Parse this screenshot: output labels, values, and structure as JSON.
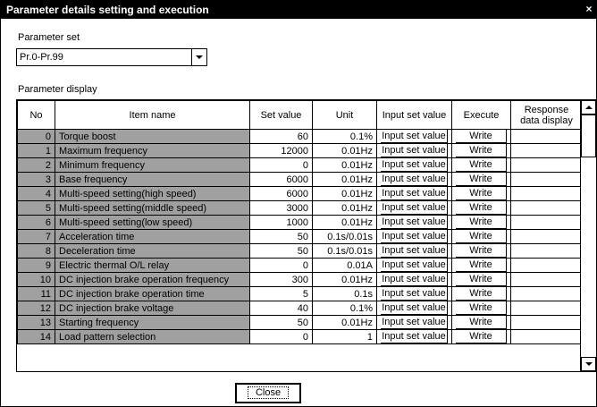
{
  "window": {
    "title": "Parameter details setting and execution",
    "close_glyph": "×"
  },
  "parameter_set": {
    "label": "Parameter set",
    "selected": "Pr.0-Pr.99"
  },
  "parameter_display": {
    "label": "Parameter display"
  },
  "table": {
    "headers": {
      "no": "No",
      "item_name": "Item name",
      "set_value": "Set value",
      "unit": "Unit",
      "input_set_value": "Input set value",
      "execute": "Execute",
      "response": "Response data display"
    },
    "rows": [
      {
        "no": "0",
        "name": "Torque boost",
        "value": "60",
        "unit": "0.1%",
        "input": "Input set value",
        "execute": "Write",
        "response": ""
      },
      {
        "no": "1",
        "name": "Maximum frequency",
        "value": "12000",
        "unit": "0.01Hz",
        "input": "Input set value",
        "execute": "Write",
        "response": ""
      },
      {
        "no": "2",
        "name": "Minimum frequency",
        "value": "0",
        "unit": "0.01Hz",
        "input": "Input set value",
        "execute": "Write",
        "response": ""
      },
      {
        "no": "3",
        "name": "Base frequency",
        "value": "6000",
        "unit": "0.01Hz",
        "input": "Input set value",
        "execute": "Write",
        "response": ""
      },
      {
        "no": "4",
        "name": "Multi-speed setting(high speed)",
        "value": "6000",
        "unit": "0.01Hz",
        "input": "Input set value",
        "execute": "Write",
        "response": ""
      },
      {
        "no": "5",
        "name": "Multi-speed setting(middle speed)",
        "value": "3000",
        "unit": "0.01Hz",
        "input": "Input set value",
        "execute": "Write",
        "response": ""
      },
      {
        "no": "6",
        "name": "Multi-speed setting(low speed)",
        "value": "1000",
        "unit": "0.01Hz",
        "input": "Input set value",
        "execute": "Write",
        "response": ""
      },
      {
        "no": "7",
        "name": "Acceleration time",
        "value": "50",
        "unit": "0.1s/0.01s",
        "input": "Input set value",
        "execute": "Write",
        "response": ""
      },
      {
        "no": "8",
        "name": "Deceleration time",
        "value": "50",
        "unit": "0.1s/0.01s",
        "input": "Input set value",
        "execute": "Write",
        "response": ""
      },
      {
        "no": "9",
        "name": "Electric thermal O/L relay",
        "value": "0",
        "unit": "0.01A",
        "input": "Input set value",
        "execute": "Write",
        "response": ""
      },
      {
        "no": "10",
        "name": "DC injection brake operation frequency",
        "value": "300",
        "unit": "0.01Hz",
        "input": "Input set value",
        "execute": "Write",
        "response": ""
      },
      {
        "no": "11",
        "name": "DC injection brake operation time",
        "value": "5",
        "unit": "0.1s",
        "input": "Input set value",
        "execute": "Write",
        "response": ""
      },
      {
        "no": "12",
        "name": "DC injection brake voltage",
        "value": "40",
        "unit": "0.1%",
        "input": "Input set value",
        "execute": "Write",
        "response": ""
      },
      {
        "no": "13",
        "name": "Starting frequency",
        "value": "50",
        "unit": "0.01Hz",
        "input": "Input set value",
        "execute": "Write",
        "response": ""
      },
      {
        "no": "14",
        "name": "Load pattern selection",
        "value": "0",
        "unit": "1",
        "input": "Input set value",
        "execute": "Write",
        "response": ""
      }
    ]
  },
  "footer": {
    "close_label": "Close"
  }
}
